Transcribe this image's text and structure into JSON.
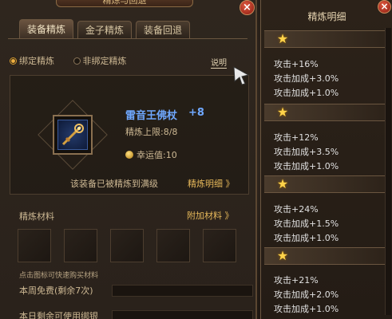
{
  "window": {
    "title": "精炼与回退",
    "close_glyph": "×"
  },
  "tabs": [
    {
      "label": "装备精炼",
      "active": true
    },
    {
      "label": "金子精炼",
      "active": false
    },
    {
      "label": "装备回退",
      "active": false
    }
  ],
  "bind_options": [
    {
      "label": "绑定精炼",
      "selected": true
    },
    {
      "label": "非绑定精炼",
      "selected": false
    }
  ],
  "help_label": "说明",
  "item": {
    "name": "雷音王佛杖",
    "refine_level": "+8",
    "cap_text": "精炼上限:8/8",
    "luck_text": "幸运值:10"
  },
  "maxed_message": "该装备已被精炼到满级",
  "detail_link": "精炼明细 》",
  "materials": {
    "label": "精炼材料",
    "extra_link": "附加材料 》",
    "hint": "点击图标可快速购买材料",
    "slot_count": 5
  },
  "free_this_week": "本周免费(剩余7次)",
  "next_row": "本日剩余可使用绑银",
  "detail_panel": {
    "title": "精炼明细",
    "close_glyph": "×",
    "groups": [
      {
        "lines": [
          "攻击+16%",
          "攻击加成+3.0%",
          "攻击加成+1.0%"
        ]
      },
      {
        "lines": [
          "攻击+12%",
          "攻击加成+3.5%",
          "攻击加成+1.0%"
        ]
      },
      {
        "lines": [
          "攻击+24%",
          "攻击加成+1.5%",
          "攻击加成+1.0%"
        ]
      },
      {
        "lines": [
          "攻击+21%",
          "攻击加成+2.0%",
          "攻击加成+1.0%"
        ]
      }
    ]
  },
  "colors": {
    "item_name": "#6fa8ff",
    "link": "#e6b85a",
    "panel_bg": "#2f261e",
    "star": "#ffd34a"
  },
  "icons": [
    "close-icon",
    "weapon-staff-icon",
    "coin-icon",
    "star-icon",
    "cursor-icon"
  ]
}
